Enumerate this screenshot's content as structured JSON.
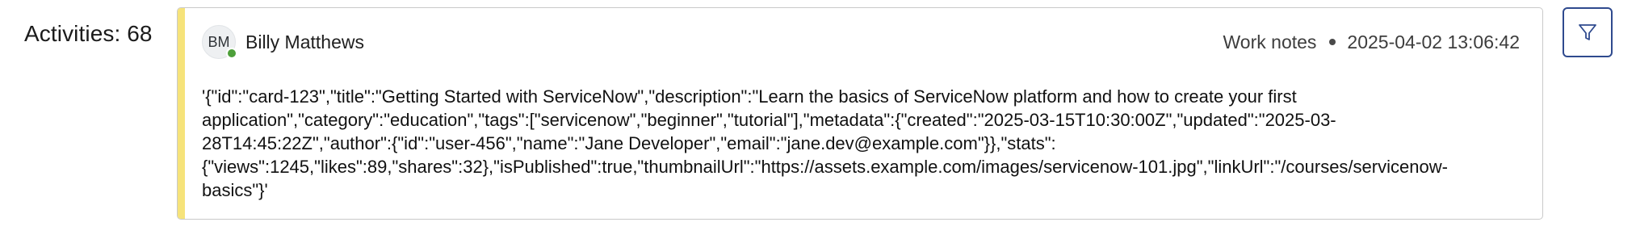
{
  "activities": {
    "label": "Activities: 68"
  },
  "entry": {
    "avatar_initials": "BM",
    "author_name": "Billy Matthews",
    "type": "Work notes",
    "timestamp": "2025-04-02 13:06:42",
    "body": "'{\"id\":\"card-123\",\"title\":\"Getting Started with ServiceNow\",\"description\":\"Learn the basics of ServiceNow platform and how to create your first application\",\"category\":\"education\",\"tags\":[\"servicenow\",\"beginner\",\"tutorial\"],\"metadata\":{\"created\":\"2025-03-15T10:30:00Z\",\"updated\":\"2025-03-28T14:45:22Z\",\"author\":{\"id\":\"user-456\",\"name\":\"Jane Developer\",\"email\":\"jane.dev@example.com\"}},\"stats\":{\"views\":1245,\"likes\":89,\"shares\":32},\"isPublished\":true,\"thumbnailUrl\":\"https://assets.example.com/images/servicenow-101.jpg\",\"linkUrl\":\"/courses/servicenow-basics\"}'"
  },
  "icons": {
    "filter": "filter-icon",
    "presence": "online-status"
  },
  "colors": {
    "accent_bar": "#f6e37a",
    "presence_online": "#4d9f3a",
    "filter_border": "#2f4a8e"
  }
}
